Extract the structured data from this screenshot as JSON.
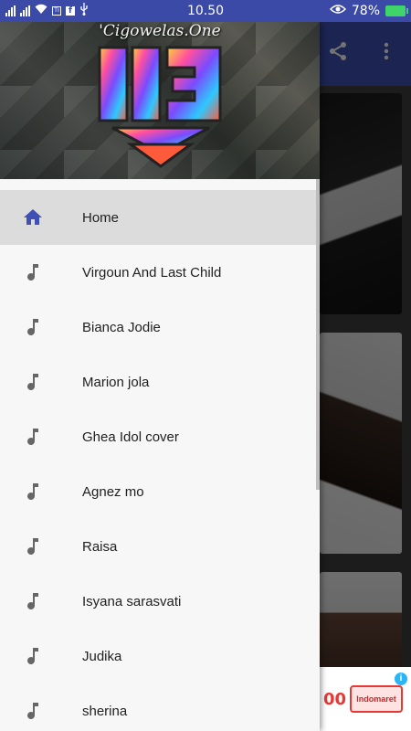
{
  "status_bar": {
    "time": "10.50",
    "battery": "78%",
    "bg_color": "#3a4aa6"
  },
  "app": {
    "toolbar_color": "#3f51b5",
    "toolbar_icons": [
      "share-icon",
      "more-vert-icon"
    ]
  },
  "drawer": {
    "header_title": "'Cigowelas.One",
    "logo_text": "ŨΞ",
    "items": [
      {
        "label": "Home",
        "icon": "home-icon",
        "active": true
      },
      {
        "label": "Virgoun And Last Child",
        "icon": "music-note-icon",
        "active": false
      },
      {
        "label": "Bianca Jodie",
        "icon": "music-note-icon",
        "active": false
      },
      {
        "label": "Marion jola",
        "icon": "music-note-icon",
        "active": false
      },
      {
        "label": "Ghea Idol cover",
        "icon": "music-note-icon",
        "active": false
      },
      {
        "label": "Agnez mo",
        "icon": "music-note-icon",
        "active": false
      },
      {
        "label": "Raisa",
        "icon": "music-note-icon",
        "active": false
      },
      {
        "label": "Isyana sarasvati",
        "icon": "music-note-icon",
        "active": false
      },
      {
        "label": "Judika",
        "icon": "music-note-icon",
        "active": false
      },
      {
        "label": "sherina",
        "icon": "music-note-icon",
        "active": false
      }
    ],
    "accent_color": "#3f51b5"
  },
  "ad": {
    "text": "00",
    "brand": "Indomaret"
  }
}
